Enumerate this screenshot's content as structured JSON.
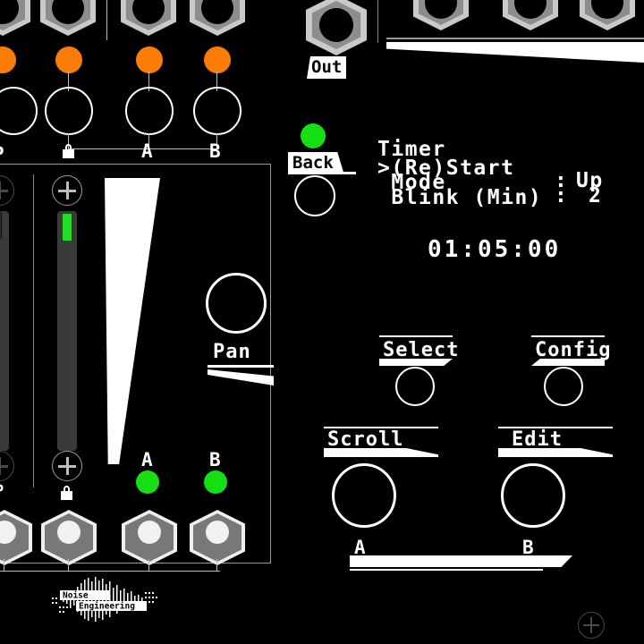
{
  "module": {
    "brand": "Noise Engineering",
    "colors": {
      "background": "#000000",
      "led_orange": "#fb7c07",
      "led_green": "#14e014",
      "panel_white": "#ffffff",
      "jack_grey": "#8d8d8d",
      "fader_slot": "#3a3a3a",
      "fader_handle": "#22dd22"
    }
  },
  "mixer": {
    "channel_labels": [
      "P",
      "lock",
      "A",
      "B"
    ],
    "visible_labels": [
      "A",
      "B"
    ],
    "lock_label": "lock-icon",
    "pan_label": "Pan",
    "led_labels": [
      "A",
      "B"
    ]
  },
  "output": {
    "jack_label": "Out"
  },
  "screen": {
    "back_label": "Back",
    "title": "Timer",
    "menu": [
      {
        "cursor": ">",
        "label": "(Re)Start",
        "value": ""
      },
      {
        "cursor": " ",
        "label": "Mode",
        "sep": ":",
        "value": "Up"
      },
      {
        "cursor": " ",
        "label": "Blink (Min)",
        "sep": ":",
        "value": "2"
      }
    ],
    "lines": {
      "l1": "Timer",
      "l2": ">(Re)Start",
      "l3": " Mode",
      "l4": " Blink (Min)",
      "l3_sep": ":",
      "l4_sep": ":",
      "l3_val": "Up",
      "l4_val": "2"
    },
    "clock": "01:05:00"
  },
  "controls": {
    "select_label": "Select",
    "config_label": "Config",
    "scroll_label": "Scroll",
    "edit_label": "Edit",
    "a_label": "A",
    "b_label": "B"
  }
}
